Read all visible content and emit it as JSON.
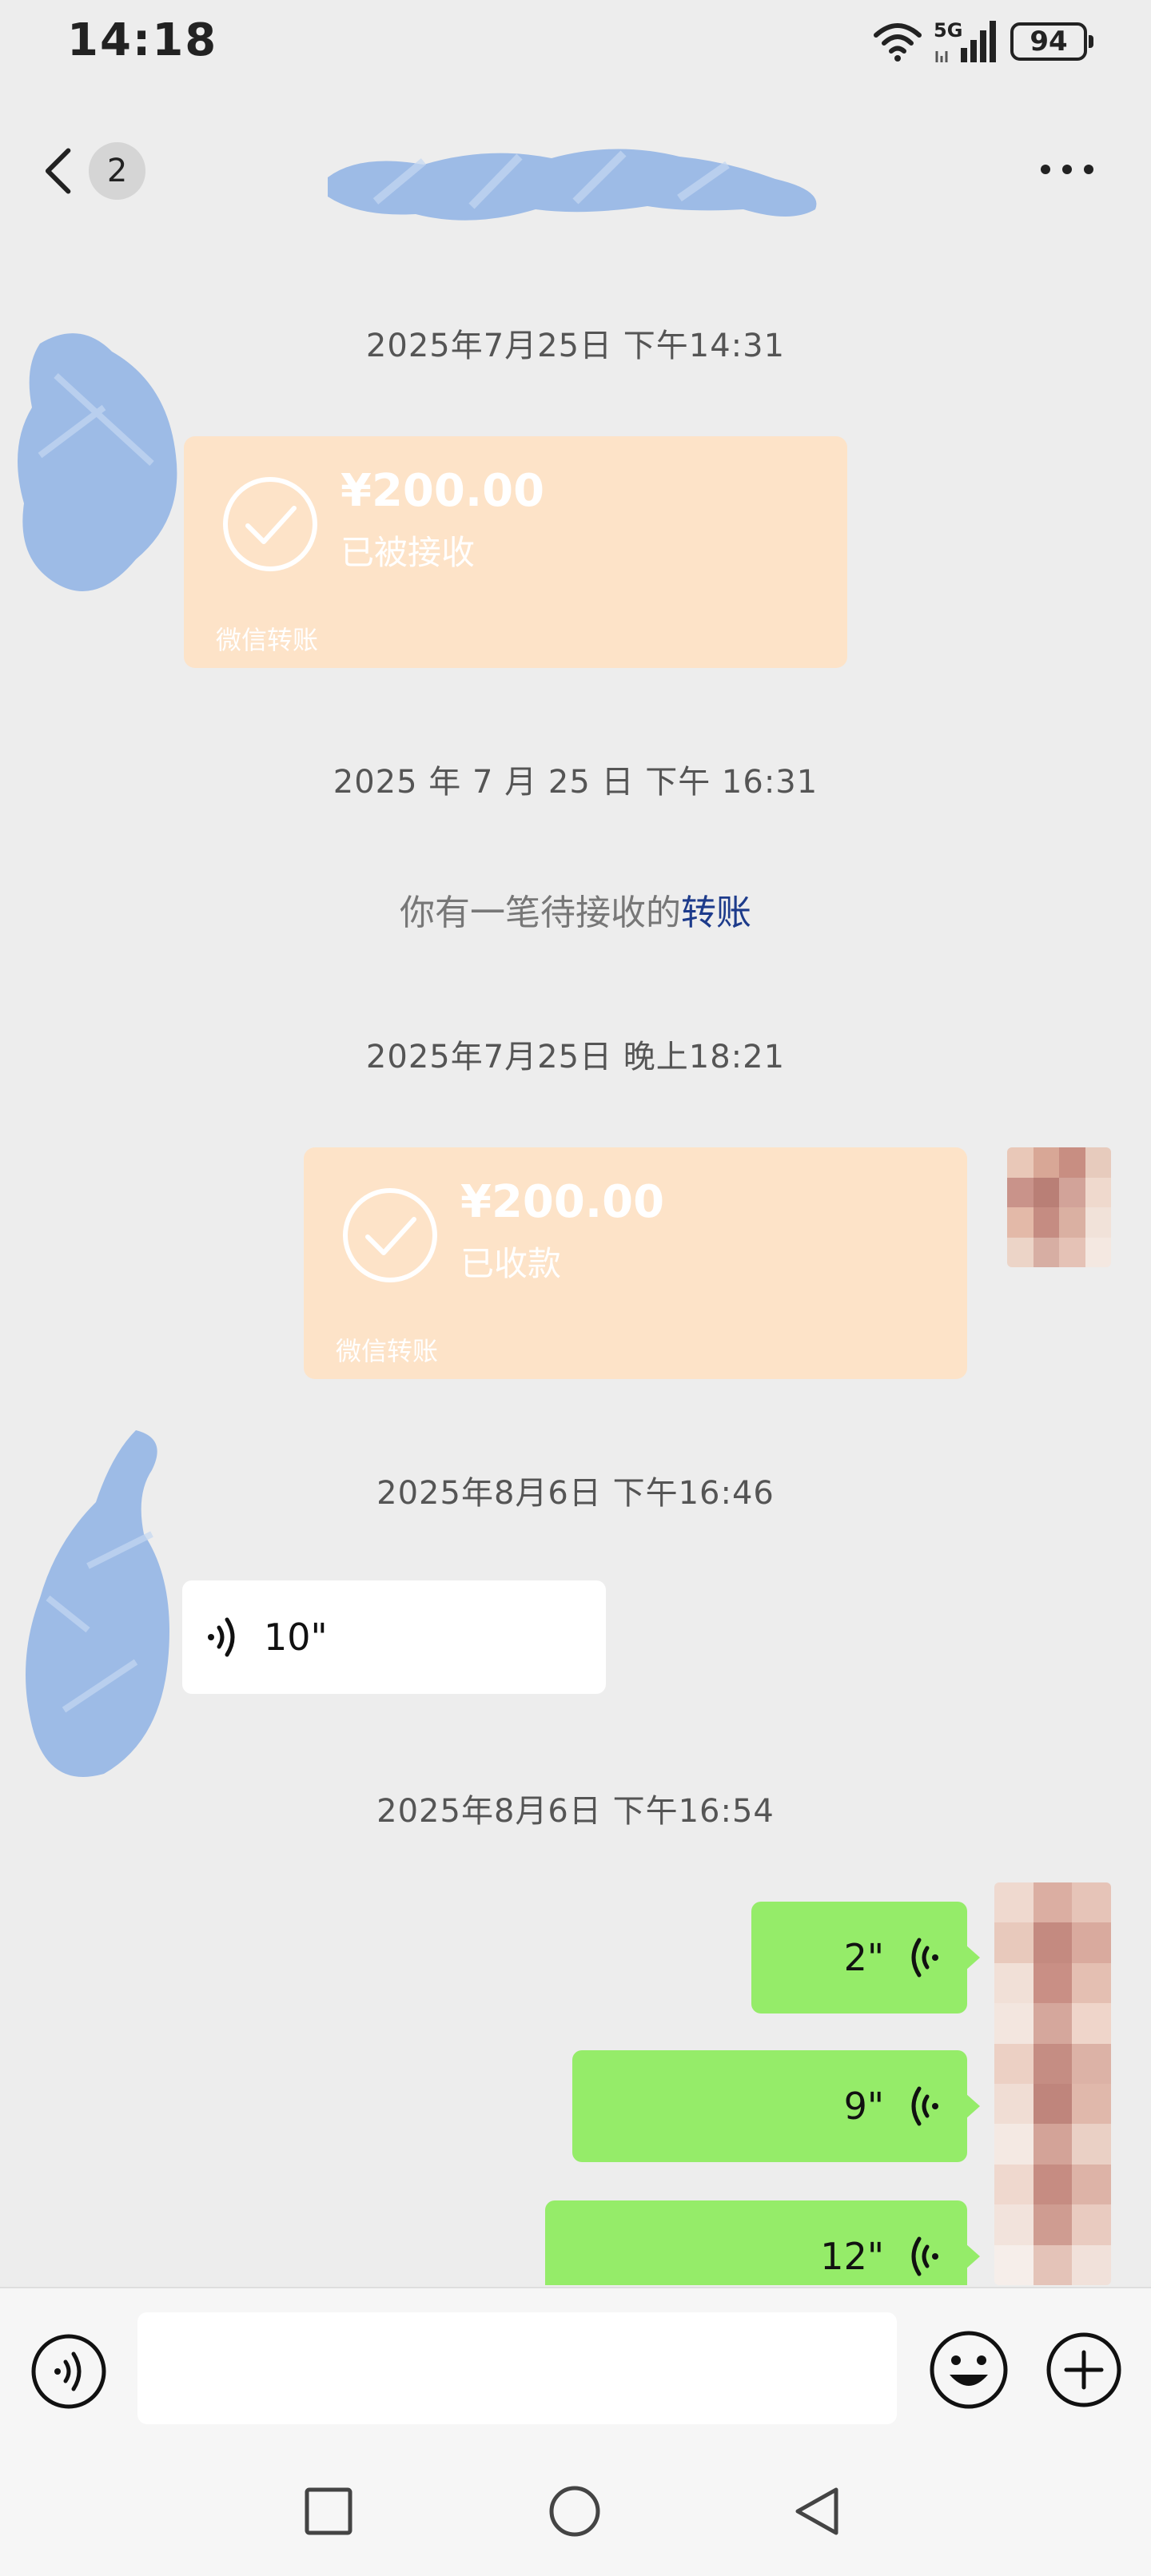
{
  "status_bar": {
    "time": "14:18",
    "network": "5G",
    "battery": "94"
  },
  "header": {
    "unread_count": "2",
    "contact_name": ""
  },
  "messages": {
    "ts1": "2025年7月25日 下午14:31",
    "transfer1": {
      "amount": "¥200.00",
      "status": "已被接收",
      "footer": "微信转账"
    },
    "ts2": "2025 年 7 月 25 日 下午 16:31",
    "system": {
      "text": "你有一笔待接收的",
      "link": "转账"
    },
    "ts3": "2025年7月25日 晚上18:21",
    "transfer2": {
      "amount": "¥200.00",
      "status": "已收款",
      "footer": "微信转账"
    },
    "ts4": "2025年8月6日 下午16:46",
    "voice_in": {
      "duration": "10\""
    },
    "ts5": "2025年8月6日 下午16:54",
    "voice_out": [
      {
        "duration": "2\""
      },
      {
        "duration": "9\""
      },
      {
        "duration": "12\""
      }
    ]
  },
  "input": {
    "placeholder": ""
  },
  "colors": {
    "background": "#ededed",
    "transfer_card": "#fde3c8",
    "outgoing_bubble": "#95ec69",
    "incoming_bubble": "#ffffff",
    "link": "#1d3b8b",
    "redaction": "#9dbbe6"
  },
  "icons": {
    "status": [
      "wifi-icon",
      "signal-icon",
      "battery-icon"
    ],
    "header": [
      "back-chevron-icon",
      "more-icon"
    ],
    "input_bar": [
      "voice-toggle-icon",
      "emoji-icon",
      "plus-icon"
    ],
    "nav": [
      "recents-icon",
      "home-icon",
      "back-icon"
    ]
  }
}
